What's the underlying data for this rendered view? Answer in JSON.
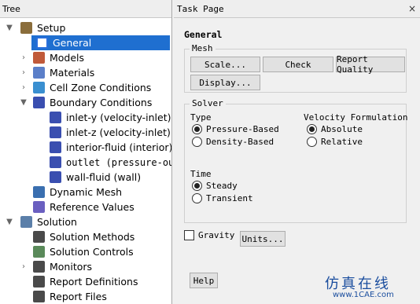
{
  "tree_panel": {
    "title": "Tree",
    "items": [
      {
        "label": "Setup",
        "caret": "▼",
        "icon": "setup-icon",
        "color": "#8a6d3b",
        "mono": false
      },
      {
        "label": "General",
        "caret": "",
        "icon": "general-icon",
        "color": "#2a6fdb",
        "mono": false
      },
      {
        "label": "Models",
        "caret": "›",
        "icon": "models-icon",
        "color": "#c05a3a",
        "mono": false
      },
      {
        "label": "Materials",
        "caret": "›",
        "icon": "materials-icon",
        "color": "#5b7fc9",
        "mono": false
      },
      {
        "label": "Cell Zone Conditions",
        "caret": "›",
        "icon": "cell-zone-icon",
        "color": "#3a8fd0",
        "mono": false
      },
      {
        "label": "Boundary Conditions",
        "caret": "▼",
        "icon": "boundary-icon",
        "color": "#3a4fb0",
        "mono": false
      },
      {
        "label": "inlet-y (velocity-inlet)",
        "caret": "",
        "icon": "boundary-item-icon",
        "color": "#3a4fb0",
        "mono": false
      },
      {
        "label": "inlet-z (velocity-inlet)",
        "caret": "",
        "icon": "boundary-item-icon",
        "color": "#3a4fb0",
        "mono": false
      },
      {
        "label": "interior-fluid (interior)",
        "caret": "",
        "icon": "boundary-item-icon",
        "color": "#3a4fb0",
        "mono": false
      },
      {
        "label": "outlet (pressure-out…",
        "caret": "",
        "icon": "boundary-item-icon",
        "color": "#3a4fb0",
        "mono": true
      },
      {
        "label": "wall-fluid (wall)",
        "caret": "",
        "icon": "boundary-item-icon",
        "color": "#3a4fb0",
        "mono": false
      },
      {
        "label": "Dynamic Mesh",
        "caret": "",
        "icon": "dynamic-mesh-icon",
        "color": "#3a6fb0",
        "mono": false
      },
      {
        "label": "Reference Values",
        "caret": "",
        "icon": "reference-values-icon",
        "color": "#6a5fc0",
        "mono": false
      },
      {
        "label": "Solution",
        "caret": "▼",
        "icon": "solution-icon",
        "color": "#5b7fa9",
        "mono": false
      },
      {
        "label": "Solution Methods",
        "caret": "",
        "icon": "solution-methods-icon",
        "color": "#4a4a4a",
        "mono": false
      },
      {
        "label": "Solution Controls",
        "caret": "",
        "icon": "solution-controls-icon",
        "color": "#5a8a5a",
        "mono": false
      },
      {
        "label": "Monitors",
        "caret": "›",
        "icon": "monitors-icon",
        "color": "#4a4a4a",
        "mono": false
      },
      {
        "label": "Report Definitions",
        "caret": "",
        "icon": "report-definitions-icon",
        "color": "#4a4a4a",
        "mono": false
      },
      {
        "label": "Report Files",
        "caret": "",
        "icon": "report-files-icon",
        "color": "#4a4a4a",
        "mono": false
      }
    ]
  },
  "task_panel": {
    "title": "Task Page",
    "close": "×",
    "page_title": "General",
    "mesh": {
      "title": "Mesh",
      "scale": "Scale...",
      "check": "Check",
      "report_quality": "Report Quality",
      "display": "Display..."
    },
    "solver": {
      "title": "Solver",
      "type_label": "Type",
      "pressure_based": "Pressure-Based",
      "density_based": "Density-Based",
      "velocity_label": "Velocity Formulation",
      "absolute": "Absolute",
      "relative": "Relative",
      "time_label": "Time",
      "steady": "Steady",
      "transient": "Transient"
    },
    "gravity": "Gravity",
    "units": "Units...",
    "help": "Help"
  },
  "watermark": {
    "text": "仿真在线",
    "url": "www.1CAE.com"
  }
}
